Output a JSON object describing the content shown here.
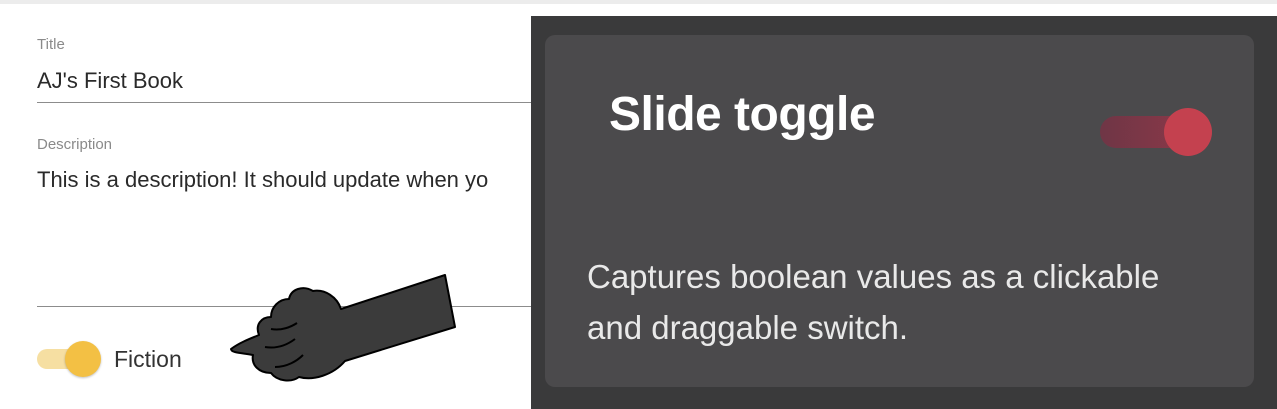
{
  "form": {
    "title_label": "Title",
    "title_value": "AJ's First Book",
    "description_label": "Description",
    "description_value": "This is a description! It should update when yo",
    "fiction_label": "Fiction",
    "fiction_on": true
  },
  "tooltip": {
    "title": "Slide toggle",
    "description": "Captures boolean values as a clickable and draggable switch.",
    "toggle_on": true,
    "accent_color": "#c4414f"
  },
  "colors": {
    "toggle_accent": "#f3c044",
    "toggle_track": "#f6dfa2"
  }
}
